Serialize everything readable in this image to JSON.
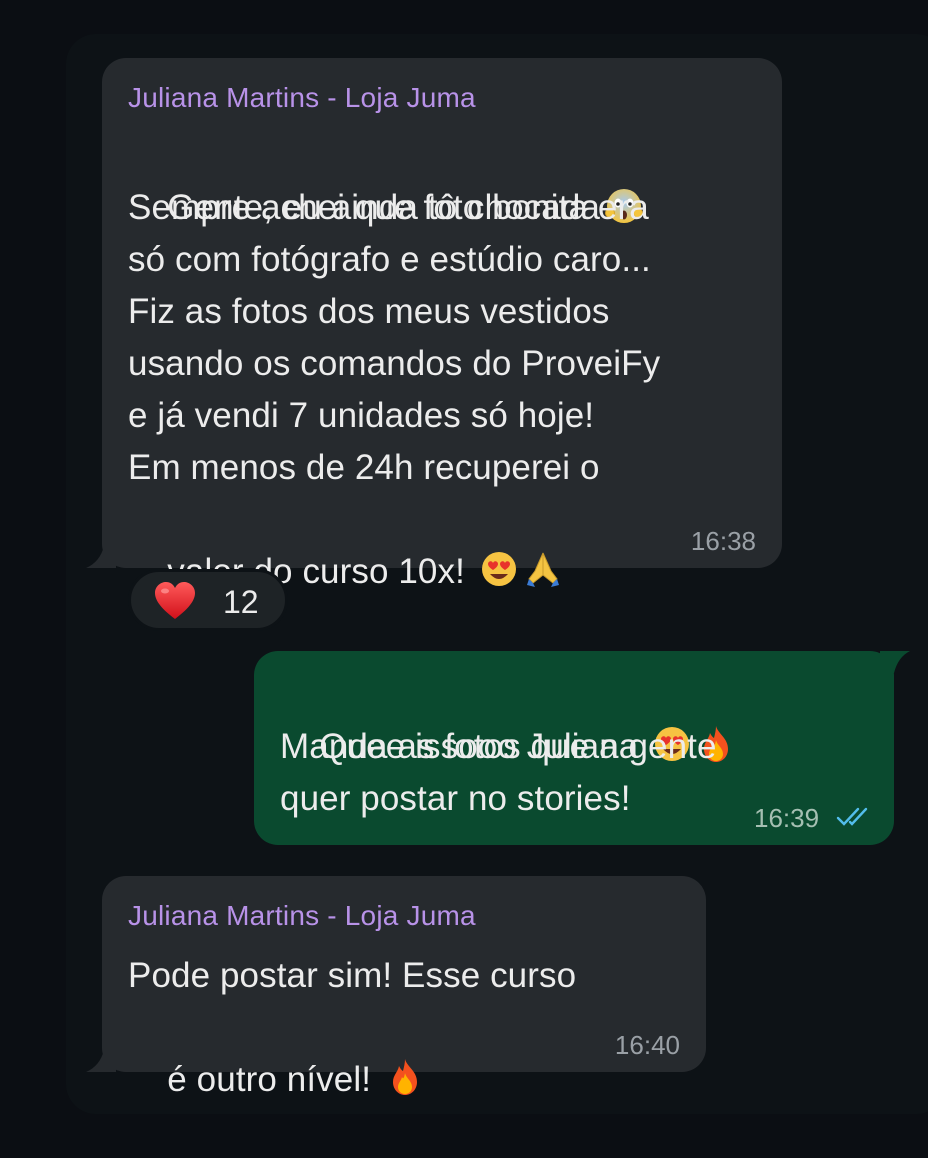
{
  "messages": [
    {
      "direction": "incoming",
      "sender": "Juliana Martins - Loja Juma",
      "lines": [
        "Gente, eu ainda tô chocada",
        "Sempre achei que foto bonita era",
        "só com fotógrafo e estúdio caro...",
        "Fiz as fotos dos meus vestidos",
        "usando os comandos do ProveiFy",
        "e já vendi 7 unidades só hoje!",
        "Em menos de 24h recuperei o",
        "valor do curso 10x!"
      ],
      "emojis": [
        "face-screaming-in-fear",
        "smiling-face-with-heart-eyes",
        "folded-hands"
      ],
      "time": "16:38",
      "reaction": {
        "emoji": "red-heart",
        "count": "12"
      }
    },
    {
      "direction": "outgoing",
      "lines": [
        "Quee issooo Juliana",
        "Manda as fotos que a gente",
        "quer postar no stories!"
      ],
      "emojis": [
        "smiling-face-with-heart-eyes",
        "fire"
      ],
      "time": "16:39",
      "status": "read"
    },
    {
      "direction": "incoming",
      "sender": "Juliana Martins - Loja Juma",
      "lines": [
        "Pode postar sim! Esse curso",
        "é outro nível!"
      ],
      "emojis": [
        "fire"
      ],
      "time": "16:40"
    }
  ],
  "colors": {
    "background": "#0b0e13",
    "panel": "#0d1216",
    "incoming_bubble": "#262a2e",
    "outgoing_bubble": "#0a4a2f",
    "sender_name": "#b892e8",
    "read_ticks": "#53bdeb"
  }
}
